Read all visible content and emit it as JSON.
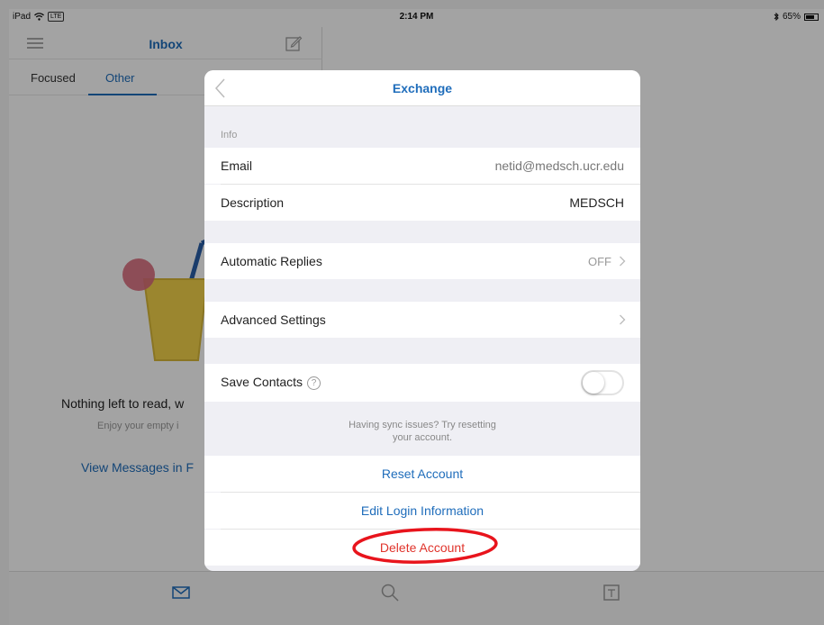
{
  "status_bar": {
    "device": "iPad",
    "signal": "LTE",
    "time": "2:14 PM",
    "battery": "65%",
    "battery_level": 0.65
  },
  "inbox": {
    "title": "Inbox",
    "tabs": [
      {
        "label": "Focused"
      },
      {
        "label": "Other"
      }
    ],
    "empty_title": "Nothing left to read, w",
    "empty_subtitle": "Enjoy your empty i",
    "empty_link": "View Messages in F"
  },
  "modal": {
    "title": "Exchange",
    "info_label": "Info",
    "email_label": "Email",
    "email_value": "netid@medsch.ucr.edu",
    "description_label": "Description",
    "description_value": "MEDSCH",
    "auto_replies_label": "Automatic Replies",
    "auto_replies_value": "OFF",
    "advanced_label": "Advanced Settings",
    "save_contacts_label": "Save Contacts",
    "save_contacts_on": false,
    "sync_note_line1": "Having sync issues? Try resetting",
    "sync_note_line2": "your account.",
    "reset_label": "Reset Account",
    "edit_login_label": "Edit Login Information",
    "delete_label": "Delete Account"
  },
  "colors": {
    "accent": "#1f6dbb",
    "danger": "#e0342c",
    "annotation": "#e8141c"
  },
  "icons": {
    "menu": "hamburger-icon",
    "compose": "compose-icon",
    "back": "chevron-left-icon",
    "mail": "mail-icon",
    "search": "search-icon",
    "calendar": "calendar-icon",
    "help": "question-icon"
  }
}
